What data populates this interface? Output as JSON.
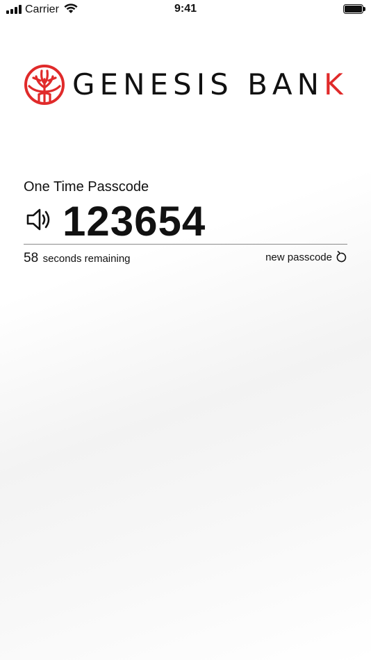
{
  "status_bar": {
    "carrier": "Carrier",
    "time": "9:41",
    "icons": [
      "signal-icon",
      "wifi-icon",
      "battery-icon"
    ]
  },
  "brand": {
    "name_part1": "GENESIS BAN",
    "name_part2": "K",
    "accent_color": "#e02a2a",
    "logo_icon": "tree-logo-icon"
  },
  "otp": {
    "label": "One Time Passcode",
    "code": "123654",
    "audio_icon": "speaker-icon",
    "seconds": "58",
    "seconds_text": "seconds remaining",
    "new_label": "new passcode",
    "new_icon": "refresh-icon"
  }
}
